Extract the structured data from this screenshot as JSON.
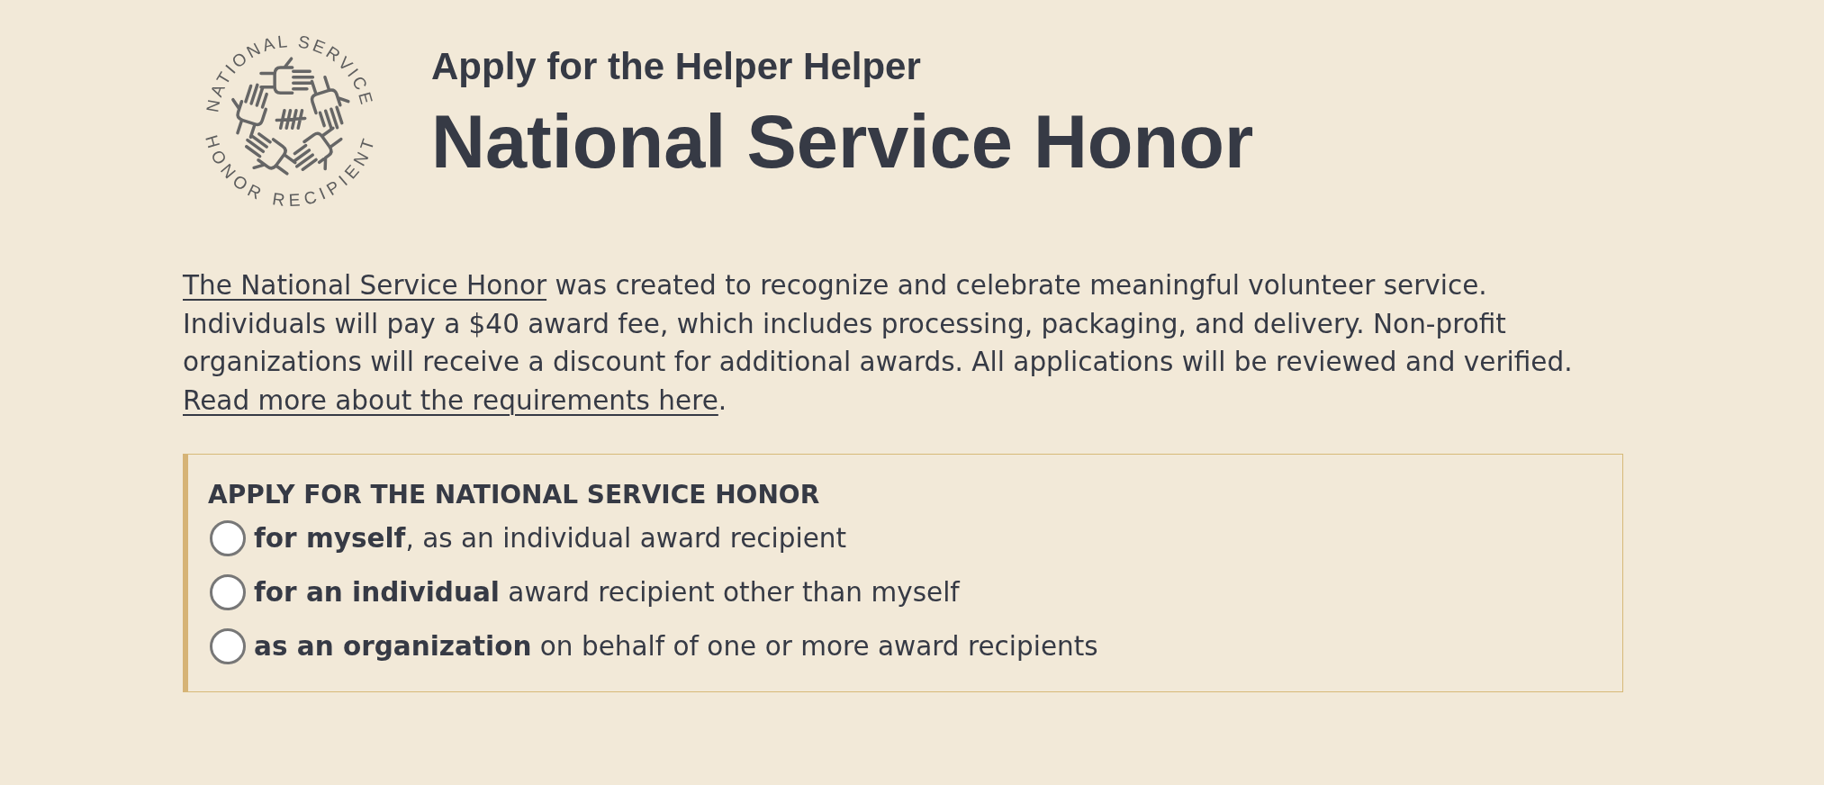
{
  "logo": {
    "top_text": "NATIONAL SERVICE",
    "bottom_text": "HONOR RECIPIENT"
  },
  "header": {
    "subtitle": "Apply for the Helper Helper",
    "title": "National Service Honor"
  },
  "intro": {
    "segments": [
      {
        "kind": "link",
        "text": "The National Service Honor"
      },
      {
        "kind": "text",
        "text": " was created to recognize and celebrate meaningful volunteer service. Individuals will pay a $40 award fee, which includes processing, packaging, and delivery. Non-profit organizations will receive a discount for additional awards. All applications will be reviewed and verified. "
      },
      {
        "kind": "link",
        "text": "Read more about the requirements here"
      },
      {
        "kind": "text",
        "text": "."
      }
    ]
  },
  "application_form": {
    "heading": "APPLY FOR THE NATIONAL SERVICE HONOR",
    "options": [
      {
        "label": "**for myself**, as an individual award recipient",
        "selected": false
      },
      {
        "label": "**for an individual** award recipient other than myself",
        "selected": false
      },
      {
        "label": "**as an organization** on behalf of one or more award recipients",
        "selected": false
      }
    ]
  }
}
